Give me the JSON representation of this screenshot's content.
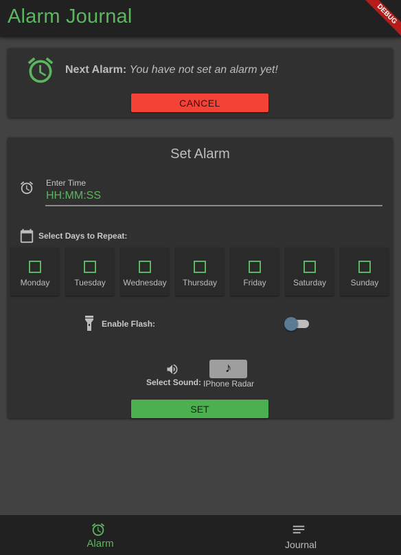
{
  "app_bar": {
    "title": "Alarm Journal",
    "debug_badge": "DEBUG"
  },
  "next_alarm_card": {
    "label": "Next Alarm:",
    "value": "You have not set an alarm yet!",
    "cancel_label": "CANCEL"
  },
  "set_alarm_card": {
    "title": "Set Alarm",
    "time_label": "Enter Time",
    "time_placeholder": "HH:MM:SS",
    "days_label": "Select Days to Repeat:",
    "days": [
      {
        "name": "Monday",
        "checked": false
      },
      {
        "name": "Tuesday",
        "checked": false
      },
      {
        "name": "Wednesday",
        "checked": false
      },
      {
        "name": "Thursday",
        "checked": false
      },
      {
        "name": "Friday",
        "checked": false
      },
      {
        "name": "Saturday",
        "checked": false
      },
      {
        "name": "Sunday",
        "checked": false
      }
    ],
    "flash_label": "Enable Flash:",
    "flash_enabled": false,
    "sound_label": "Select Sound:",
    "sound_name": "IPhone Radar",
    "note_icon": "music-note-icon",
    "set_label": "SET"
  },
  "bottom_nav": {
    "items": [
      {
        "label": "Alarm",
        "icon": "alarm-icon",
        "active": true
      },
      {
        "label": "Journal",
        "icon": "notes-icon",
        "active": false
      }
    ]
  },
  "colors": {
    "accent": "#5cb660",
    "cancel": "#f44336",
    "set": "#4caf50",
    "background": "#424242",
    "card": "#303030"
  }
}
